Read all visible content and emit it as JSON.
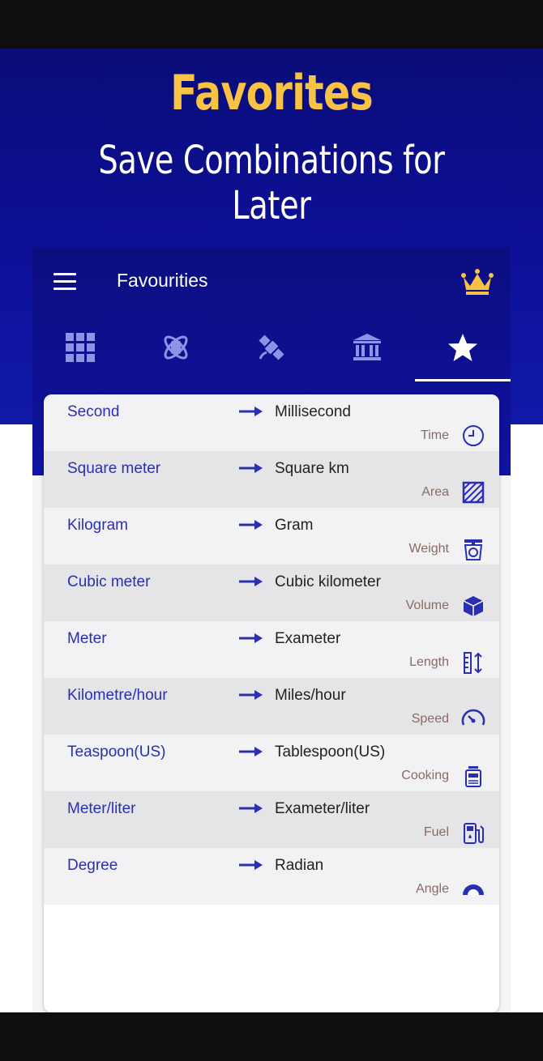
{
  "promo": {
    "headline": "Favorites",
    "subline": "Save Combinations for Later"
  },
  "appbar": {
    "title": "Favourities",
    "menu_icon": "hamburger-menu-icon",
    "premium_icon": "crown-icon"
  },
  "tabs": [
    {
      "name": "grid",
      "icon": "grid-icon"
    },
    {
      "name": "science",
      "icon": "atom-icon"
    },
    {
      "name": "engineering",
      "icon": "satellite-icon"
    },
    {
      "name": "finance",
      "icon": "bank-icon"
    },
    {
      "name": "favourites",
      "icon": "star-icon",
      "active": true
    }
  ],
  "favorites": [
    {
      "from": "Second",
      "to": "Millisecond",
      "category": "Time",
      "icon": "clock-icon"
    },
    {
      "from": "Square meter",
      "to": "Square km",
      "category": "Area",
      "icon": "area-icon"
    },
    {
      "from": "Kilogram",
      "to": "Gram",
      "category": "Weight",
      "icon": "scale-icon"
    },
    {
      "from": "Cubic meter",
      "to": "Cubic kilometer",
      "category": "Volume",
      "icon": "cube-icon"
    },
    {
      "from": "Meter",
      "to": "Exameter",
      "category": "Length",
      "icon": "ruler-icon"
    },
    {
      "from": "Kilometre/hour",
      "to": "Miles/hour",
      "category": "Speed",
      "icon": "speedometer-icon"
    },
    {
      "from": "Teaspoon(US)",
      "to": "Tablespoon(US)",
      "category": "Cooking",
      "icon": "kitchen-scale-icon"
    },
    {
      "from": "Meter/liter",
      "to": "Exameter/liter",
      "category": "Fuel",
      "icon": "fuel-pump-icon"
    },
    {
      "from": "Degree",
      "to": "Radian",
      "category": "Angle",
      "icon": "protractor-icon"
    }
  ],
  "colors": {
    "accent_blue": "#2a2fb0",
    "headline_gold": "#f8c245",
    "appbar_blue": "#0f13a0"
  }
}
